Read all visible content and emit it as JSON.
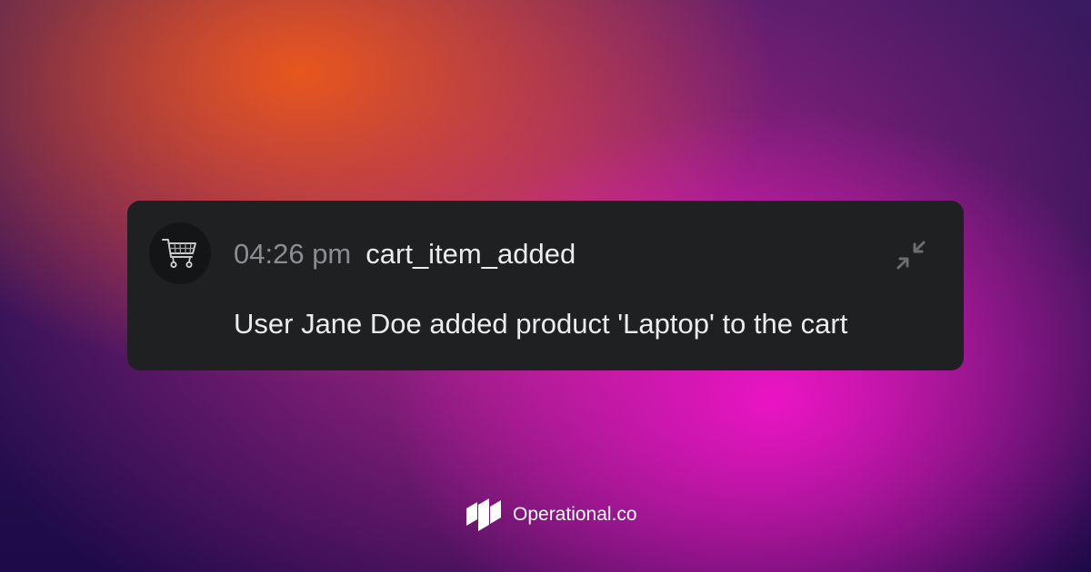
{
  "event_card": {
    "icon": "shopping-cart-icon",
    "time": "04:26 pm",
    "event_name": "cart_item_added",
    "message": "User Jane Doe added product 'Laptop' to the cart",
    "collapse_icon": "minimize-arrows-icon"
  },
  "brand": {
    "logo_icon": "operational-logo-icon",
    "name": "Operational.co"
  },
  "colors": {
    "card_background": "#1f2022",
    "avatar_background": "#141516",
    "time_text": "#8b8d91",
    "primary_text": "#ececec",
    "icon_gray": "#6b6d71",
    "background_orange": "#e8561e",
    "background_magenta": "#f014c8",
    "background_deep_purple": "#1e0a48"
  }
}
